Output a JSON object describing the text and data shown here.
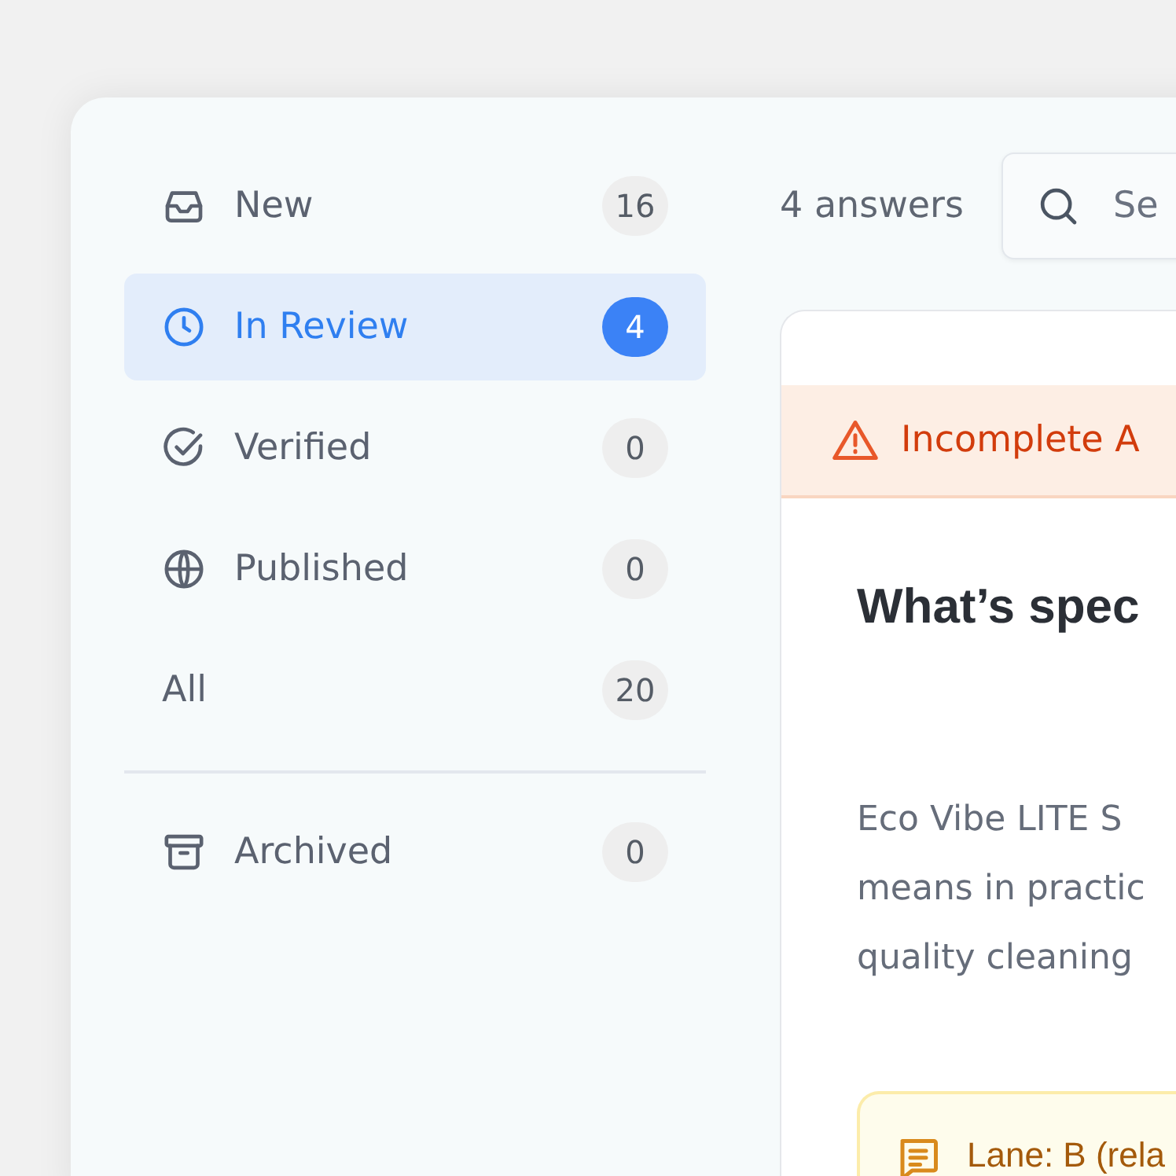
{
  "sidebar": {
    "items": [
      {
        "label": "New",
        "count": "16",
        "selected": false
      },
      {
        "label": "In Review",
        "count": "4",
        "selected": true
      },
      {
        "label": "Verified",
        "count": "0",
        "selected": false
      },
      {
        "label": "Published",
        "count": "0",
        "selected": false
      },
      {
        "label": "All",
        "count": "20",
        "selected": false
      }
    ],
    "footer_items": [
      {
        "label": "Archived",
        "count": "0",
        "selected": false
      }
    ]
  },
  "main": {
    "answer_count": "4 answers",
    "search": {
      "placeholder": "Se"
    },
    "card": {
      "warning": "Incomplete A",
      "question": "What’s spec",
      "body": [
        "Eco Vibe LITE S",
        "means in practic",
        "quality cleaning"
      ],
      "note": "Lane: B (rela"
    }
  }
}
